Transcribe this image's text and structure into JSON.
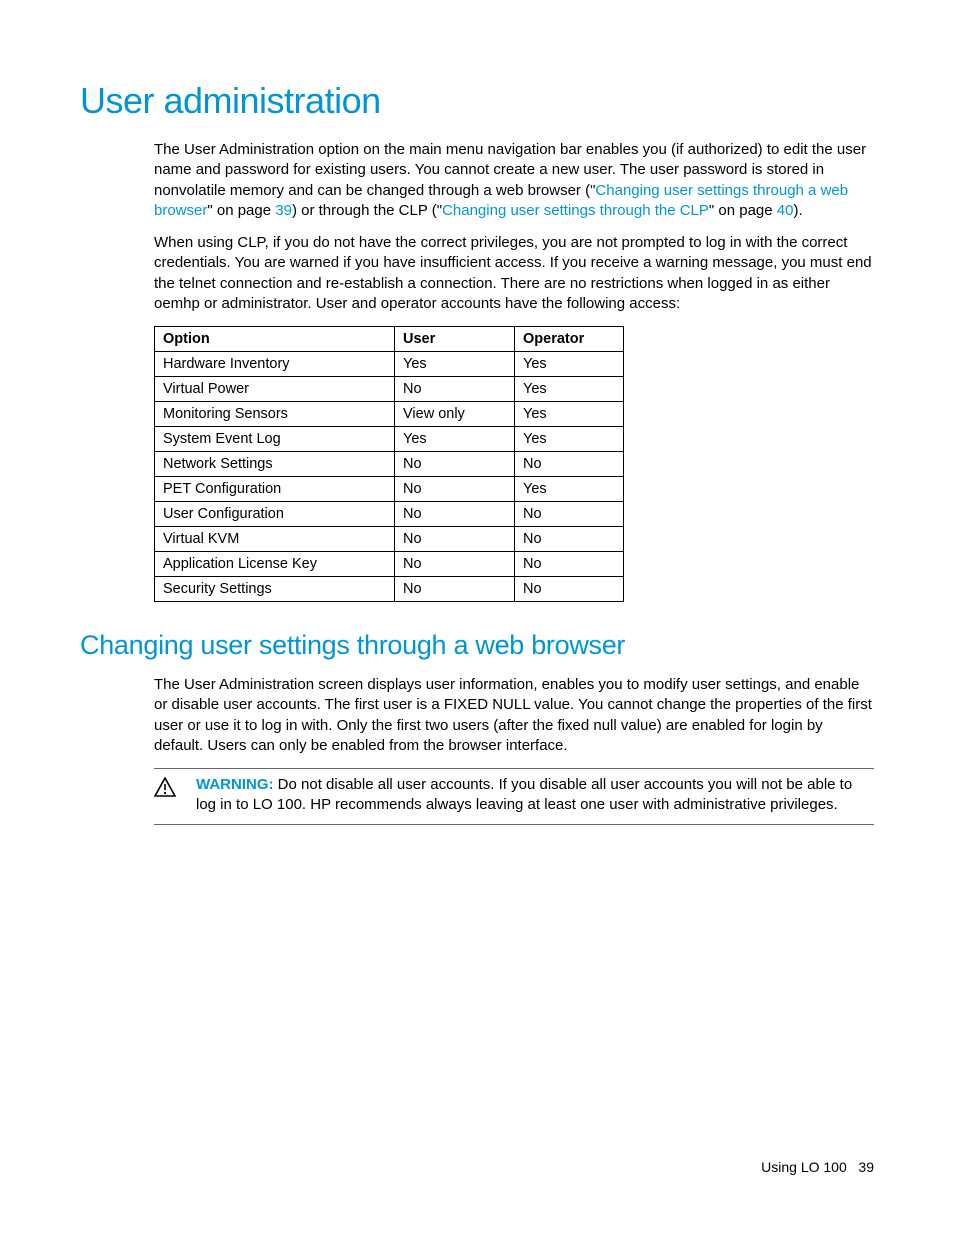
{
  "heading1": "User administration",
  "para1_a": "The User Administration option on the main menu navigation bar enables you (if authorized) to edit the user name and password for existing users. You cannot create a new user. The user password is stored in nonvolatile memory and can be changed through a web browser (\"",
  "link1": "Changing user settings through a web browser",
  "para1_b": "\" on page ",
  "pageref1": "39",
  "para1_c": ") or through the CLP (\"",
  "link2": "Changing user settings through the CLP",
  "para1_d": "\" on page ",
  "pageref2": "40",
  "para1_e": ").",
  "para2": "When using CLP, if you do not have the correct privileges, you are not prompted to log in with the correct credentials. You are warned if you have insufficient access. If you receive a warning message, you must end the telnet connection and re-establish a connection. There are no restrictions when logged in as either oemhp or administrator. User and operator accounts have the following access:",
  "table": {
    "headers": [
      "Option",
      "User",
      "Operator"
    ],
    "rows": [
      [
        "Hardware Inventory",
        "Yes",
        "Yes"
      ],
      [
        "Virtual Power",
        "No",
        "Yes"
      ],
      [
        "Monitoring Sensors",
        "View only",
        "Yes"
      ],
      [
        "System Event Log",
        "Yes",
        "Yes"
      ],
      [
        "Network Settings",
        "No",
        "No"
      ],
      [
        "PET Configuration",
        "No",
        "Yes"
      ],
      [
        "User Configuration",
        "No",
        "No"
      ],
      [
        "Virtual KVM",
        "No",
        "No"
      ],
      [
        "Application License Key",
        "No",
        "No"
      ],
      [
        "Security Settings",
        "No",
        "No"
      ]
    ]
  },
  "heading2": "Changing user settings through a web browser",
  "para3": "The User Administration screen displays user information, enables you to modify user settings, and enable or disable user accounts. The first user is a FIXED NULL value. You cannot change the properties of the first user or use it to log in with. Only the first two users (after the fixed null value) are enabled for login by default. Users can only be enabled from the browser interface.",
  "warning_label": "WARNING:",
  "warning_text": "  Do not disable all user accounts. If you disable all user accounts you will not be able to log in to LO 100. HP recommends always leaving at least one user with administrative privileges.",
  "footer_text": "Using LO 100",
  "footer_page": "39"
}
